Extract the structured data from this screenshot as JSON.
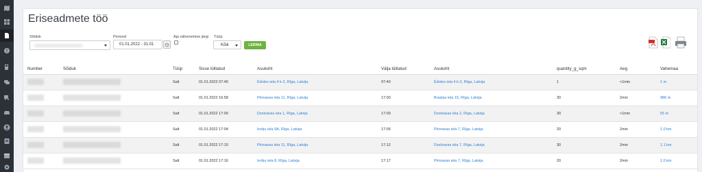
{
  "page": {
    "title": "Eriseadmete töö"
  },
  "filters": {
    "vehicle_label": "Sõiduk",
    "period_label": "Periood",
    "period_value": "01.01.2022 - 31.01",
    "by_duration_label": "Aja vähenemise järgi",
    "type_label": "Tüüp",
    "type_value": "Kõik",
    "search_button": "LEIDMA"
  },
  "sidebar": {
    "icons": [
      "map-icon",
      "dashboard-icon",
      "document-icon",
      "alert-icon",
      "fuel-icon",
      "chat-icon",
      "trailer-icon",
      "car-icon",
      "user-icon",
      "id-card-icon",
      "calendar-icon",
      "settings-icon"
    ]
  },
  "export": {
    "icons": [
      "pdf-export-icon",
      "excel-export-icon",
      "print-icon"
    ]
  },
  "table": {
    "headers": {
      "number": "Number",
      "vehicle": "Sõiduk",
      "type": "Tüüp",
      "switched_on": "Sisse lülitatud",
      "location_start": "Asukoht",
      "switched_off": "Välja lülitatud",
      "location_end": "Asukoht",
      "quantity": "quantity_g_sqm",
      "time": "Aeg",
      "distance": "Vahemaa"
    },
    "rows": [
      {
        "type": "Salt",
        "on": "01.01.2022 07:40",
        "loc1": "Ēdoles iela 4 k-2, Rīga, Latvija",
        "off": "07:40",
        "loc2": "Ēdoles iela 4 k-2, Rīga, Latvija",
        "qty": "1",
        "time": "<1min",
        "dist": "1 m"
      },
      {
        "type": "Salt",
        "on": "01.01.2022 16:58",
        "loc1": "Pērnavas iela 11, Rīga, Latvija",
        "off": "17:00",
        "loc2": "Brasļas iela 15, Rīga, Latvija",
        "qty": "30",
        "time": "2min",
        "dist": "986 m"
      },
      {
        "type": "Salt",
        "on": "01.01.2022 17:00",
        "loc1": "Dzelzavas iela 1, Rīga, Latvija",
        "off": "17:00",
        "loc2": "Dzelzavas iela 2, Rīga, Latvija",
        "qty": "30",
        "time": "<1min",
        "dist": "55 m"
      },
      {
        "type": "Salt",
        "on": "01.01.2022 17:04",
        "loc1": "Ieriķu iela 9A, Rīga, Latvija",
        "off": "17:06",
        "loc2": "Pērnavas iela 7, Rīga, Latvija",
        "qty": "20",
        "time": "2min",
        "dist": "1.0 km"
      },
      {
        "type": "Salt",
        "on": "01.01.2022 17:10",
        "loc1": "Pērnavas iela 11, Rīga, Latvija",
        "off": "17:12",
        "loc2": "Dzelzavas iela 7, Rīga, Latvija",
        "qty": "30",
        "time": "2min",
        "dist": "1.1 km"
      },
      {
        "type": "Salt",
        "on": "01.01.2022 17:16",
        "loc1": "Ieriķu iela 8, Rīga, Latvija",
        "off": "17:17",
        "loc2": "Pērnavas iela 7, Rīga, Latvija",
        "qty": "20",
        "time": "2min",
        "dist": "1.0 km"
      }
    ]
  }
}
